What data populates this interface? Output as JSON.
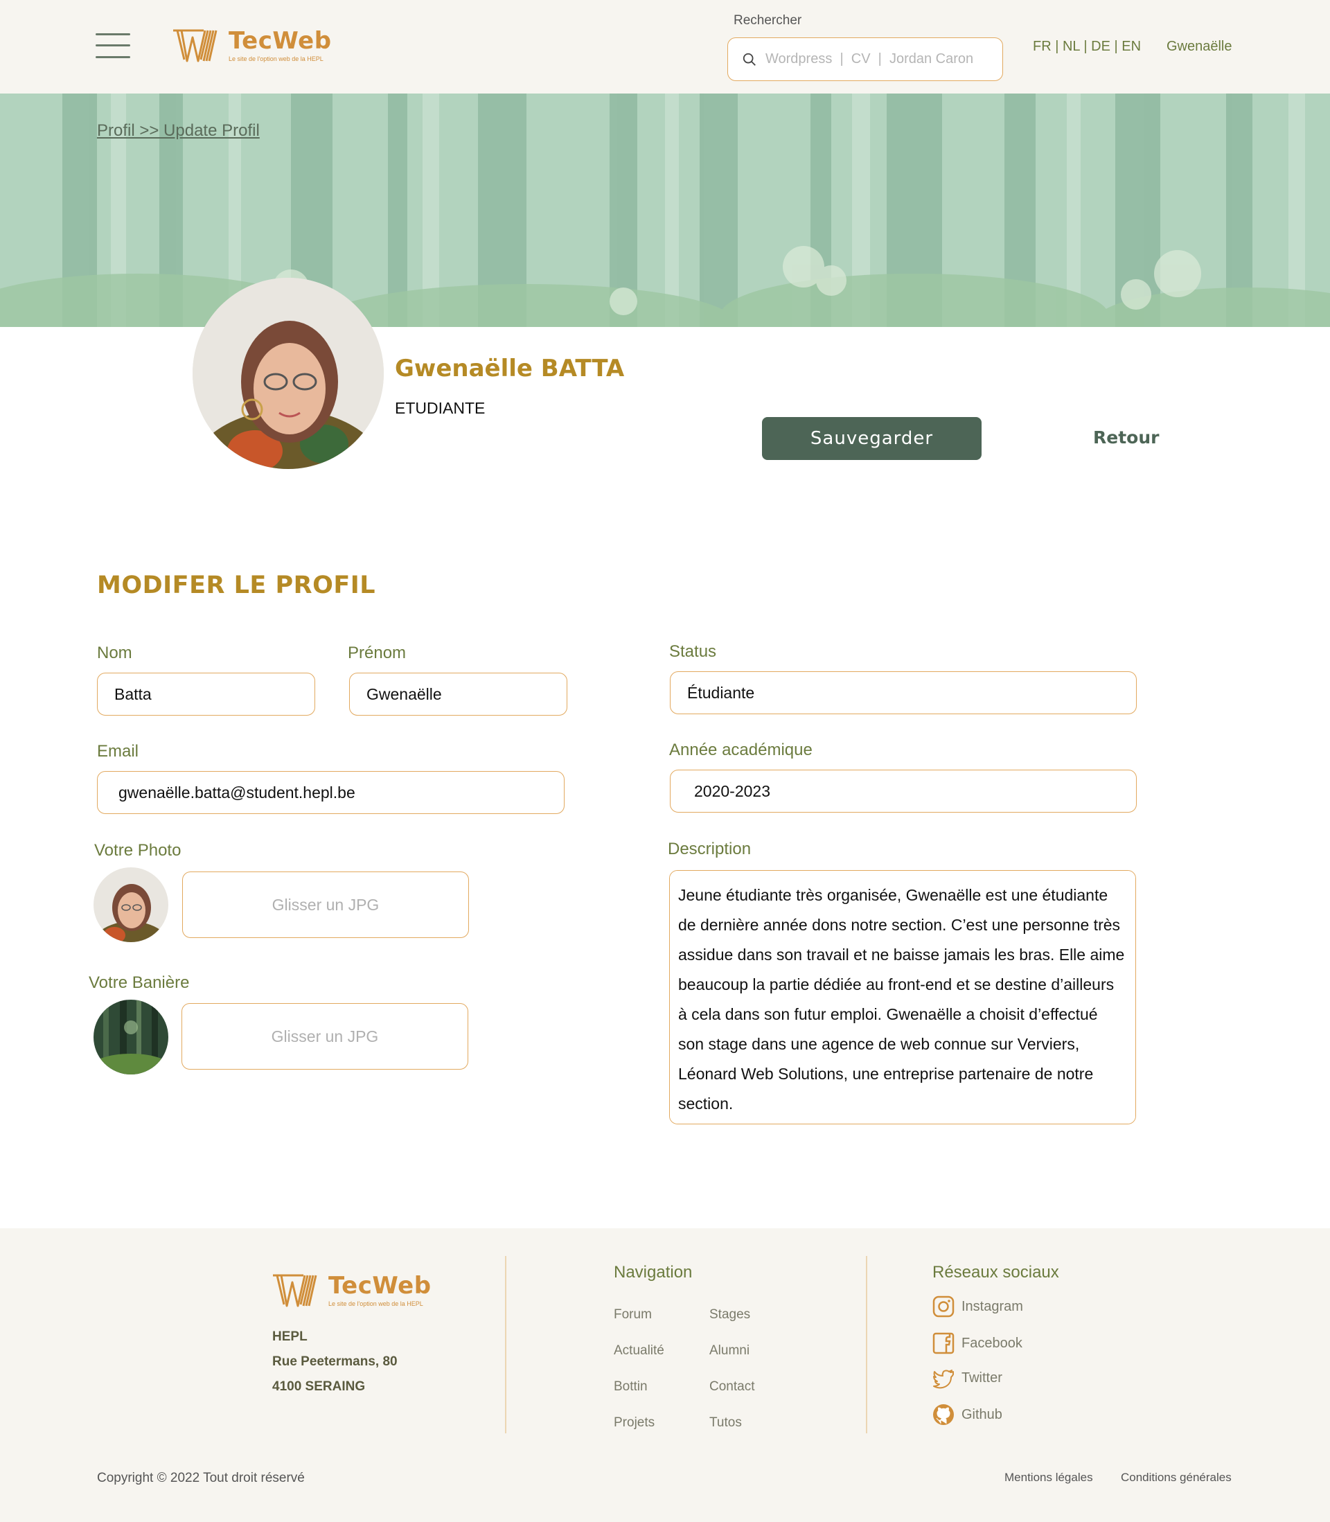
{
  "header": {
    "logo_name": "TecWeb",
    "logo_tagline": "Le site de l'option web de la HEPL",
    "search_label": "Rechercher",
    "search_placeholder": "Wordpress  |  CV  |  Jordan Caron",
    "languages": [
      "FR",
      "NL",
      "DE",
      "EN"
    ],
    "lang_sep": " | ",
    "user": "Gwenaëlle"
  },
  "banner": {
    "breadcrumb": "Profil >> Update Profil"
  },
  "profile": {
    "name": "Gwenaëlle BATTA",
    "role": "ETUDIANTE",
    "save_label": "Sauvegarder",
    "back_label": "Retour"
  },
  "form": {
    "title": "MODIFER LE PROFIL",
    "nom_label": "Nom",
    "nom_value": "Batta",
    "prenom_label": "Prénom",
    "prenom_value": "Gwenaëlle",
    "email_label": "Email",
    "email_value": "gwenaëlle.batta@student.hepl.be",
    "status_label": "Status",
    "status_value": "Étudiante",
    "annee_label": "Année académique",
    "annee_value": "2020-2023",
    "photo_label": "Votre Photo",
    "photo_drop": "Glisser un JPG",
    "banner_label": "Votre Banière",
    "banner_drop": "Glisser un JPG",
    "description_label": "Description",
    "description_value": "Jeune étudiante très organisée, Gwenaëlle est une étudiante de dernière année dons notre section. C’est une personne très assidue dans son travail et ne baisse jamais les bras. Elle aime beaucoup la partie dédiée au front-end et se destine d’ailleurs à cela dans son futur emploi. Gwenaëlle a choisit d’effectué son stage dans une agence de web connue sur Verviers, Léonard Web Solutions, une entreprise partenaire de notre section."
  },
  "footer": {
    "logo_name": "TecWeb",
    "logo_tagline": "Le site de l'option web de la HEPL",
    "address": [
      "HEPL",
      "Rue Peetermans, 80",
      "4100 SERAING"
    ],
    "nav_title": "Navigation",
    "nav_links": [
      "Forum",
      "Stages",
      "Actualité",
      "Alumni",
      "Bottin",
      "Contact",
      "Projets",
      "Tutos"
    ],
    "social_title": "Réseaux sociaux",
    "socials": [
      {
        "label": "Instagram",
        "icon": "instagram-icon"
      },
      {
        "label": "Facebook",
        "icon": "facebook-icon"
      },
      {
        "label": "Twitter",
        "icon": "twitter-icon"
      },
      {
        "label": "Github",
        "icon": "github-icon"
      }
    ],
    "copyright": "Copyright © 2022 Tout droit réservé",
    "legal": "Mentions légales",
    "conditions": "Conditions générales"
  },
  "colors": {
    "accent": "#b58a25",
    "logo": "#d08e3a",
    "border": "#e2a95f",
    "button": "#4d6556",
    "label": "#6b7b3e",
    "background": "#f7f5f0"
  }
}
